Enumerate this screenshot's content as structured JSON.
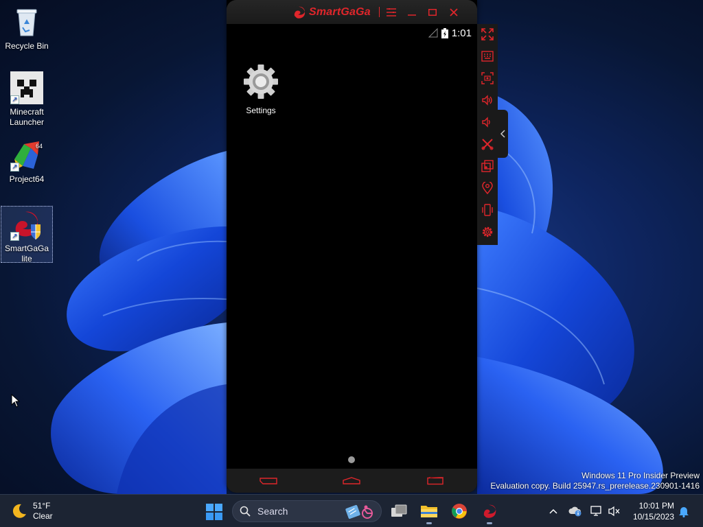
{
  "desktop": {
    "icons": [
      {
        "label": "Recycle Bin",
        "icon": "recycle-bin-icon"
      },
      {
        "label": "Minecraft Launcher",
        "icon": "minecraft-icon"
      },
      {
        "label": "Project64",
        "icon": "project64-icon"
      },
      {
        "label": "SmartGaGa lite",
        "icon": "smartgaga-icon"
      }
    ]
  },
  "emulator": {
    "title": "SmartGaGa",
    "status_time": "1:01",
    "apps": [
      {
        "label": "Settings",
        "icon": "gear-icon"
      }
    ],
    "accent_color": "#e0262b"
  },
  "watermark": {
    "line1": "Windows 11 Pro Insider Preview",
    "line2": "Evaluation copy. Build 25947.rs_prerelease.230901-1416"
  },
  "taskbar": {
    "weather_temp": "51°F",
    "weather_desc": "Clear",
    "search_placeholder": "Search",
    "time": "10:01 PM",
    "date": "10/15/2023"
  }
}
